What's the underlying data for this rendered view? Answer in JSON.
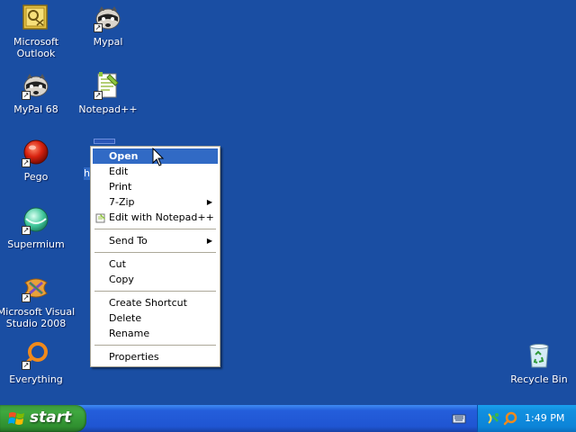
{
  "desktop": {
    "icons": [
      {
        "label": "Microsoft\nOutlook",
        "icon": "outlook-icon"
      },
      {
        "label": "Mypal",
        "icon": "mypal-raccoon-icon"
      },
      {
        "label": "MyPal 68",
        "icon": "mypal-raccoon-icon"
      },
      {
        "label": "Notepad++",
        "icon": "notepadpp-icon"
      },
      {
        "label": "Pego",
        "icon": "pego-red-orb-icon"
      },
      {
        "label": "Supermium",
        "icon": "supermium-icon"
      },
      {
        "label": "Microsoft Visual\nStudio 2008",
        "icon": "visual-studio-icon"
      },
      {
        "label": "Everything",
        "icon": "everything-search-icon"
      },
      {
        "label": "Recycle Bin",
        "icon": "recycle-bin-icon"
      }
    ],
    "selected_icon_label_fragment": "h"
  },
  "context_menu": {
    "items": [
      {
        "label": "Open",
        "bold": true,
        "highlighted": true
      },
      {
        "label": "Edit"
      },
      {
        "label": "Print"
      },
      {
        "label": "7-Zip",
        "submenu": true
      },
      {
        "label": "Edit with Notepad++",
        "icon": "notepadpp-small-icon"
      },
      {
        "label": "Send To",
        "submenu": true
      },
      {
        "label": "Cut"
      },
      {
        "label": "Copy"
      },
      {
        "label": "Create Shortcut"
      },
      {
        "label": "Delete"
      },
      {
        "label": "Rename"
      },
      {
        "label": "Properties"
      }
    ],
    "submenu_arrow": "▶"
  },
  "taskbar": {
    "start_label": "start",
    "clock": "1:49 PM"
  },
  "colors": {
    "desktop_bg": "#1a4ea3",
    "menu_highlight": "#316ac5",
    "taskbar_blue": "#245edb",
    "start_green": "#3fa83f",
    "tray_blue": "#0c84d8"
  }
}
